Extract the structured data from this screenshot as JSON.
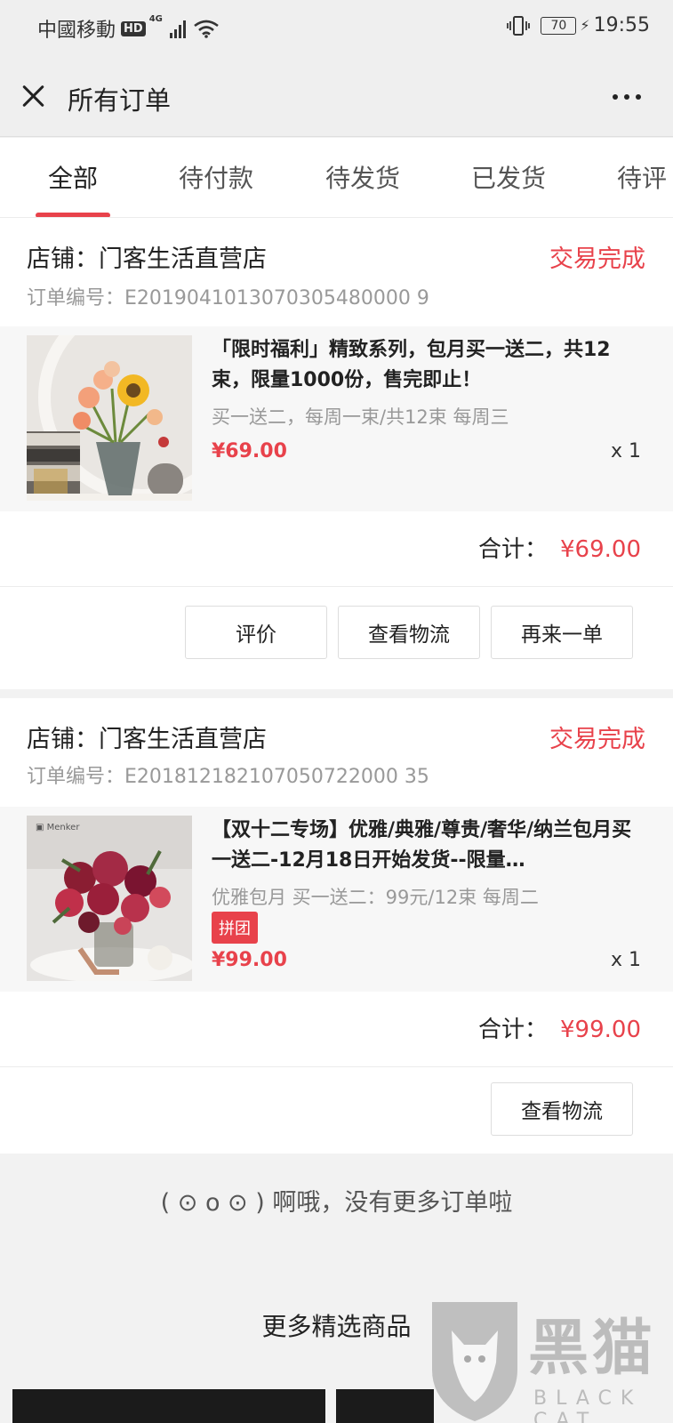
{
  "status_bar": {
    "carrier": "中國移動",
    "hd": "HD",
    "network": "4G",
    "battery": "70",
    "time": "19:55"
  },
  "header": {
    "title": "所有订单"
  },
  "tabs": [
    {
      "label": "全部"
    },
    {
      "label": "待付款"
    },
    {
      "label": "待发货"
    },
    {
      "label": "已发货"
    },
    {
      "label": "待评"
    }
  ],
  "orders": [
    {
      "store": "店铺：门客生活直营店",
      "status": "交易完成",
      "order_no": "订单编号：E2019041013070305480000 9",
      "product_name": "「限时福利」精致系列，包月买一送二，共12束，限量1000份，售完即止！",
      "spec": "买一送二，每周一束/共12束 每周三",
      "price": "¥69.00",
      "qty": "x 1",
      "total_label": "合计：",
      "total": "¥69.00",
      "buttons": [
        "评价",
        "查看物流",
        "再来一单"
      ]
    },
    {
      "store": "店铺：门客生活直营店",
      "status": "交易完成",
      "order_no": "订单编号：E201812182107050722000 35",
      "product_name": "【双十二专场】优雅/典雅/尊贵/奢华/纳兰包月买一送二-12月18日开始发货--限量…",
      "spec": "优雅包月 买一送二：99元/12束 每周二",
      "tag": "拼团",
      "price": "¥99.00",
      "qty": "x 1",
      "total_label": "合计：",
      "total": "¥99.00",
      "buttons": [
        "查看物流"
      ]
    }
  ],
  "footer": {
    "no_more": "( ⊙ o ⊙ ) 啊哦，没有更多订单啦",
    "featured": "更多精选商品"
  },
  "watermark": {
    "text": "黑猫",
    "sub": "BLACK CAT"
  },
  "colors": {
    "accent": "#e8424b",
    "page_bg": "#f2f2f2"
  }
}
